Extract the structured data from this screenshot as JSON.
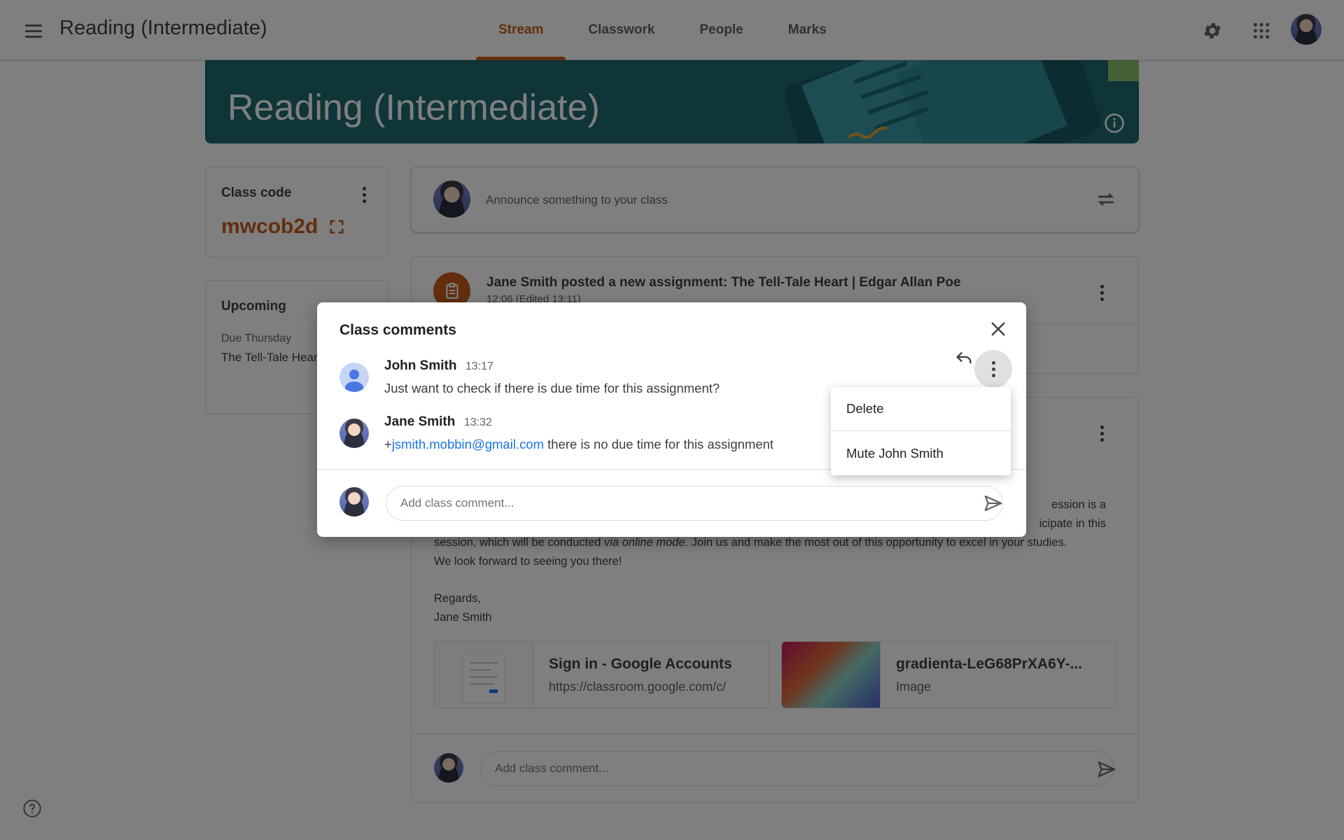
{
  "header": {
    "class_title": "Reading (Intermediate)",
    "tabs": [
      {
        "label": "Stream",
        "active": true
      },
      {
        "label": "Classwork",
        "active": false
      },
      {
        "label": "People",
        "active": false
      },
      {
        "label": "Marks",
        "active": false
      }
    ],
    "icons": [
      "menu-icon",
      "gear-icon",
      "apps-icon"
    ]
  },
  "banner": {
    "title": "Reading (Intermediate)",
    "color": "#1f6b73"
  },
  "class_code": {
    "label": "Class code",
    "value": "mwcob2d"
  },
  "upcoming": {
    "label": "Upcoming",
    "due": "Due Thursday",
    "item": "The Tell-Tale Hear"
  },
  "announce": {
    "placeholder": "Announce something to your class"
  },
  "assignment": {
    "title": "Jane Smith posted a new assignment: The Tell-Tale Heart | Edgar Allan Poe",
    "time": "12:06 (Edited 13:11)"
  },
  "post": {
    "text_line1_end": "ession is a",
    "text_line2_end": "icipate in this",
    "text_line3_a": "session, which will be conducted ",
    "text_line3_em": "via online mode",
    "text_line3_b": ". Join us and make the most out of this opportunity to excel in your studies.",
    "text_line4": "We look forward to seeing you there!",
    "regards": "Regards,",
    "signature": "Jane Smith",
    "attachments": [
      {
        "title": "Sign in - Google Accounts",
        "subtitle": "https://classroom.google.com/c/"
      },
      {
        "title": "gradienta-LeG68PrXA6Y-...",
        "subtitle": "Image"
      }
    ],
    "comment_placeholder": "Add class comment..."
  },
  "dialog": {
    "title": "Class comments",
    "comments": [
      {
        "author": "John Smith",
        "time": "13:17",
        "text": "Just want to check if there is due time for this assignment?"
      },
      {
        "author": "Jane Smith",
        "time": "13:32",
        "prefix": "+",
        "mention": "jsmith.mobbin@gmail.com",
        "text": " there is no due time for this assignment"
      }
    ],
    "input_placeholder": "Add class comment..."
  },
  "menu": {
    "items": [
      "Delete",
      "Mute John Smith"
    ]
  },
  "colors": {
    "accent": "#c65d1c",
    "link": "#1a73e8",
    "banner": "#1f6b73"
  }
}
